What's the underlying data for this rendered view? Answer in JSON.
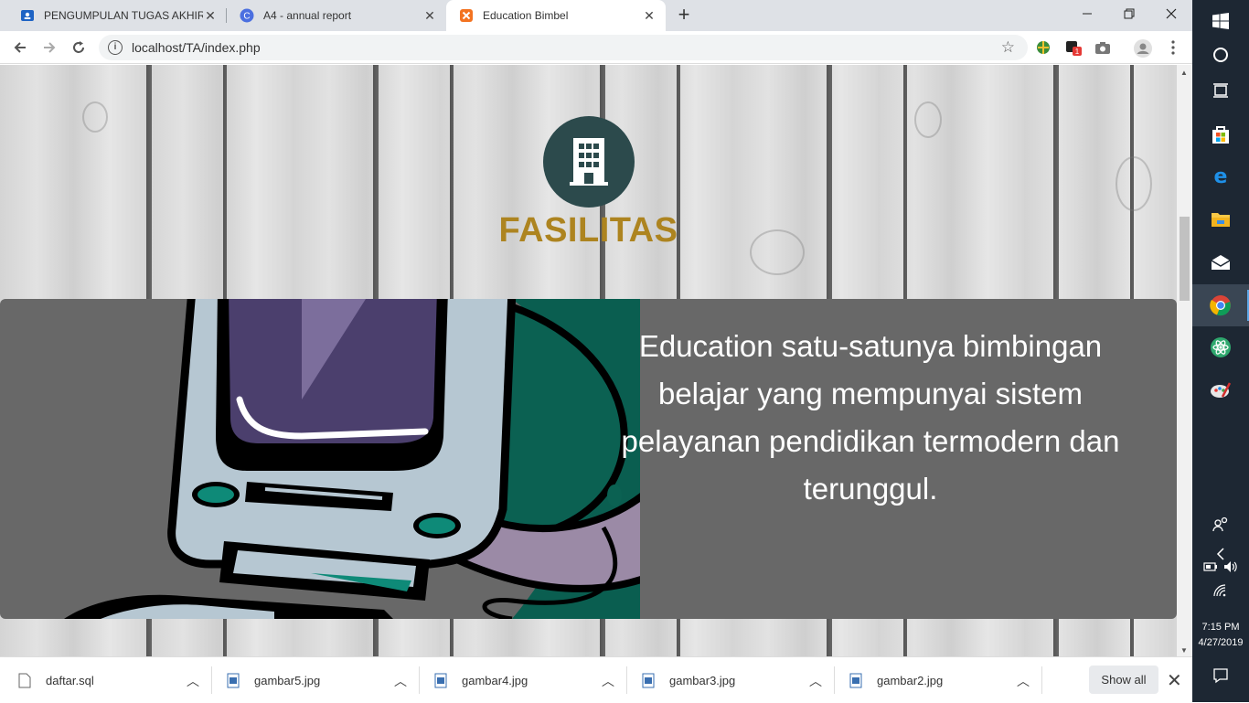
{
  "browser": {
    "tabs": [
      {
        "title": "PENGUMPULAN TUGAS AKHIR W",
        "icon": "classroom-icon"
      },
      {
        "title": "A4 - annual report",
        "icon": "canva-icon"
      },
      {
        "title": "Education Bimbel",
        "icon": "xampp-icon",
        "active": true
      }
    ],
    "new_tab": "+",
    "url": "localhost/TA/index.php"
  },
  "page": {
    "facilities_title": "FASILITAS",
    "panel_text": "Education satu-satunya bimbingan belajar yang mempunyai sistem pelayanan pendidikan termodern dan terunggul."
  },
  "downloads": {
    "items": [
      "daftar.sql",
      "gambar5.jpg",
      "gambar4.jpg",
      "gambar3.jpg",
      "gambar2.jpg"
    ],
    "show_all": "Show all"
  },
  "taskbar": {
    "time": "7:15 PM",
    "date": "4/27/2019"
  },
  "colors": {
    "title_gold": "#ad8420",
    "icon_circle": "#2c4a4c",
    "panel_gray": "#686868"
  }
}
